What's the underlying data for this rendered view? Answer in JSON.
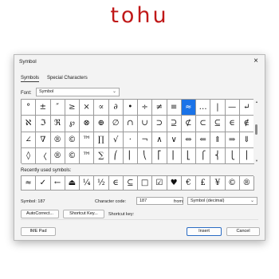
{
  "brand": "tohu",
  "dialog": {
    "title": "Symbol",
    "close_glyph": "×",
    "tabs": [
      "Symbols",
      "Special Characters"
    ],
    "font_label": "Font:",
    "font_value": "Symbol",
    "grid_rows": [
      [
        "°",
        "±",
        "″",
        "≥",
        "×",
        "∝",
        "∂",
        "•",
        "÷",
        "≠",
        "≡",
        "≈",
        "…",
        "|",
        "—",
        "↵"
      ],
      [
        "ℵ",
        "ℑ",
        "ℜ",
        "℘",
        "⊗",
        "⊕",
        "∅",
        "∩",
        "∪",
        "⊃",
        "⊇",
        "⊄",
        "⊂",
        "⊆",
        "∈",
        "∉"
      ],
      [
        "∠",
        "∇",
        "®",
        "©",
        "™",
        "∏",
        "√",
        "·",
        "¬",
        "∧",
        "∨",
        "⇔",
        "⇐",
        "⇑",
        "⇒",
        "⇓"
      ],
      [
        "◊",
        "〈",
        "®",
        "©",
        "™",
        "∑",
        "⎛",
        "⎜",
        "⎝",
        "⎡",
        "⎢",
        "⎣",
        "⎧",
        "⎨",
        "⎩",
        "⎪"
      ]
    ],
    "selected_cell": "0-11",
    "recent_label": "Recently used symbols:",
    "recent": [
      "≈",
      "✓",
      "←",
      "⏏",
      "¼",
      "½",
      "∈",
      "⊆",
      "□",
      "☑",
      "♥",
      "€",
      "£",
      "¥",
      "©",
      "®"
    ],
    "symbol_info": "Symbol: 187",
    "charcode_label": "Character code:",
    "charcode_value": "187",
    "from_label": "from:",
    "from_value": "Symbol (decimal)",
    "autocorrect_button": "AutoCorrect...",
    "shortcut_button": "Shortcut Key...",
    "shortcut_label": "Shortcut key:",
    "ime_button": "IME Pad",
    "insert_button": "Insert",
    "cancel_button": "Cancel",
    "colors": {
      "brand": "#c01818",
      "selection": "#1a73e8"
    }
  }
}
